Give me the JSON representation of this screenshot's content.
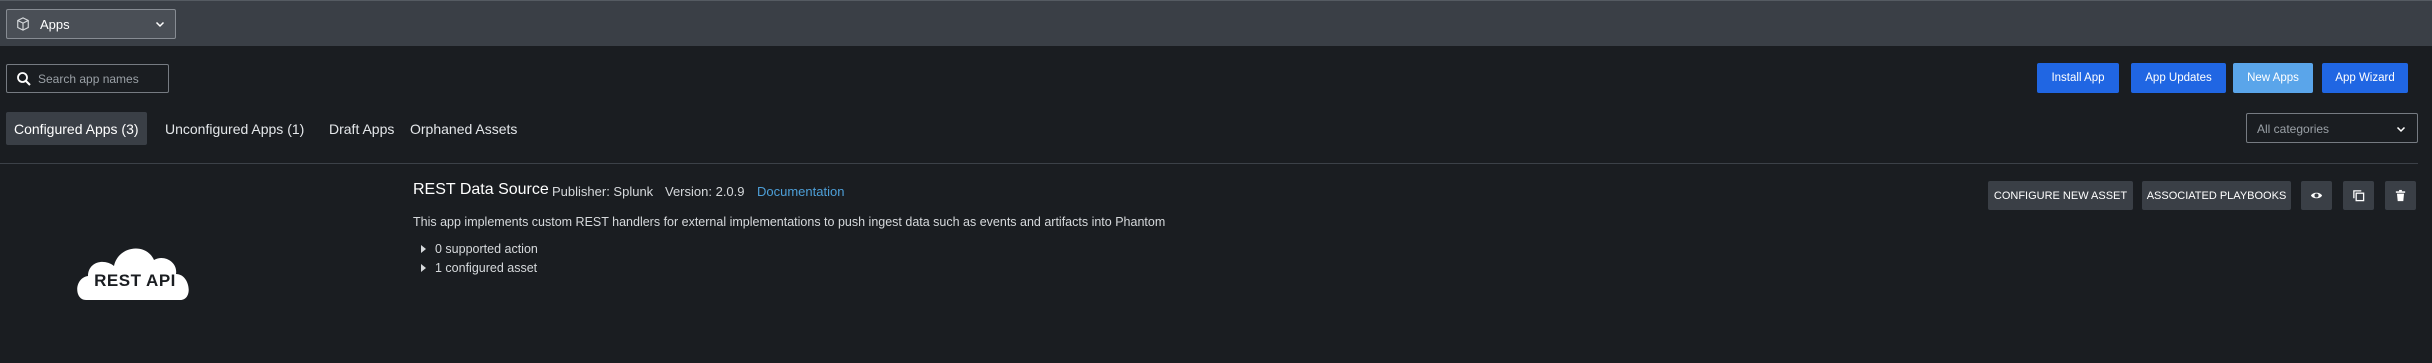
{
  "header": {
    "app_selector": {
      "label": "Apps",
      "icon": "cube-icon"
    }
  },
  "search": {
    "placeholder": "Search app names",
    "icon": "search-icon"
  },
  "actions": {
    "install_app": "Install App",
    "app_updates": "App Updates",
    "new_apps": "New Apps",
    "app_wizard": "App Wizard"
  },
  "tabs": [
    {
      "label": "Configured Apps (3)",
      "active": true
    },
    {
      "label": "Unconfigured Apps (1)",
      "active": false
    },
    {
      "label": "Draft Apps",
      "active": false
    },
    {
      "label": "Orphaned Assets",
      "active": false
    }
  ],
  "category_filter": {
    "placeholder": "All categories"
  },
  "apps": [
    {
      "logo_text": "REST API",
      "name": "REST Data Source",
      "publisher": "Publisher: Splunk",
      "version": "Version: 2.0.9",
      "documentation_link": "Documentation",
      "description": "This app implements custom REST handlers for external implementations to push ingest data such as events and artifacts into Phantom",
      "supported_actions": "0 supported action",
      "configured_assets": "1 configured asset",
      "buttons": {
        "configure_new_asset": "CONFIGURE NEW ASSET",
        "associated_playbooks": "ASSOCIATED PLAYBOOKS"
      },
      "icons": [
        "eye-icon",
        "copy-icon",
        "trash-icon"
      ]
    }
  ],
  "colors": {
    "background": "#1a1d21",
    "topbar": "#3a3f46",
    "primary_button": "#2066e3",
    "new_apps_button": "#5aa5ea",
    "link": "#4d9fd8"
  }
}
